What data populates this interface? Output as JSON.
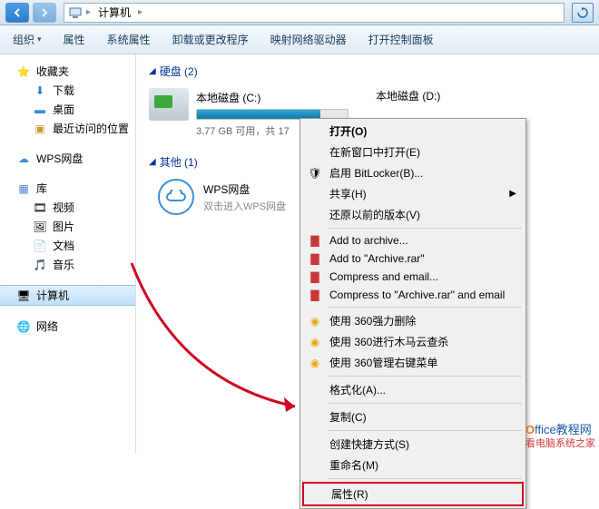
{
  "address": {
    "root": "计算机"
  },
  "toolbar": {
    "organize": "组织",
    "properties": "属性",
    "sysprops": "系统属性",
    "uninstall": "卸载或更改程序",
    "mapdrive": "映射网络驱动器",
    "controlpanel": "打开控制面板"
  },
  "sidebar": {
    "favorites": "收藏夹",
    "downloads": "下载",
    "desktop": "桌面",
    "recent": "最近访问的位置",
    "wps": "WPS网盘",
    "libraries": "库",
    "videos": "视频",
    "pictures": "图片",
    "documents": "文档",
    "music": "音乐",
    "computer": "计算机",
    "network": "网络"
  },
  "content": {
    "hd_header": "硬盘 (2)",
    "other_header": "其他 (1)",
    "drive_c": {
      "name": "本地磁盘 (C:)",
      "free": "3.77 GB 可用，共 17",
      "fill_pct": 82
    },
    "drive_d": {
      "name": "本地磁盘 (D:)"
    },
    "wps": {
      "title": "WPS网盘",
      "sub": "双击进入WPS网盘"
    }
  },
  "ctx": {
    "open": "打开(O)",
    "newwin": "在新窗口中打开(E)",
    "bitlocker": "启用 BitLocker(B)...",
    "share": "共享(H)",
    "restore": "还原以前的版本(V)",
    "add_arch": "Add to archive...",
    "add_rar": "Add to \"Archive.rar\"",
    "comp_email": "Compress and email...",
    "comp_rar_email": "Compress to \"Archive.rar\" and email",
    "del360": "使用 360强力删除",
    "scan360": "使用 360进行木马云查杀",
    "menu360": "使用 360管理右键菜单",
    "format": "格式化(A)...",
    "copy": "复制(C)",
    "shortcut": "创建快捷方式(S)",
    "rename": "重命名(M)",
    "props": "属性(R)"
  },
  "watermark": {
    "line1a": "O",
    "line1b": "ffice教程网",
    "line2": "看电脑系统之家"
  }
}
